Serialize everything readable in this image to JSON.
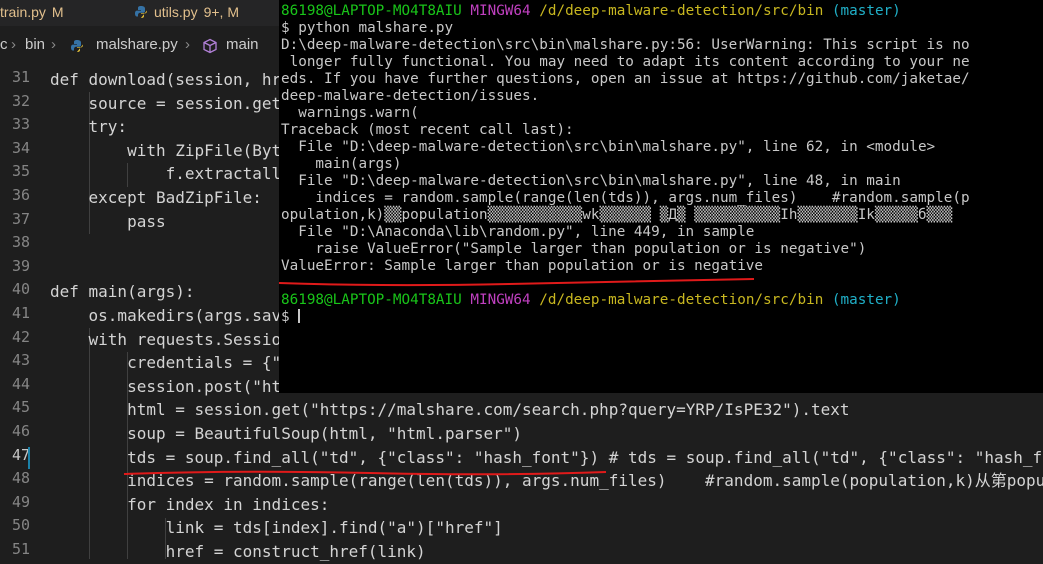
{
  "tabs": [
    {
      "name": "train.py",
      "status": "M"
    },
    {
      "name": "utils.py",
      "status": "9+, M"
    }
  ],
  "breadcrumb": [
    "c",
    "bin",
    "malshare.py",
    "main"
  ],
  "code": {
    "line_numbers": [
      "31",
      "32",
      "33",
      "34",
      "35",
      "36",
      "37",
      "38",
      "39",
      "40",
      "41",
      "42",
      "43",
      "44",
      "45",
      "46",
      "47",
      "48",
      "49",
      "50",
      "51"
    ],
    "lines": [
      "def download(session, hre",
      "    source = session.get",
      "    try:",
      "        with ZipFile(Byt",
      "            f.extractall",
      "    except BadZipFile:",
      "        pass",
      "",
      "",
      "def main(args):",
      "    os.makedirs(args.sav",
      "    with requests.Sessio",
      "        credentials = {\"",
      "        session.post(\"ht",
      "        html = session.get(\"https://malshare.com/search.php?query=YRP/IsPE32\").text",
      "        soup = BeautifulSoup(html, \"html.parser\")",
      "        tds = soup.find_all(\"td\", {\"class\": \"hash_font\"}) # tds = soup.find_all(\"td\", {\"class\": \"hash_fo",
      "        indices = random.sample(range(len(tds)), args.num_files)    #random.sample(population,k)从第popu",
      "        for index in indices:",
      "            link = tds[index].find(\"a\")[\"href\"]",
      "            href = construct_href(link)"
    ]
  },
  "terminal": {
    "prompt_user": "86198@LAPTOP-MO4T8AIU",
    "prompt_env": "MINGW64",
    "prompt_path": "/d/deep-malware-detection/src/bin",
    "prompt_branch": "(master)",
    "command": "$ python malshare.py",
    "output": [
      "D:\\deep-malware-detection\\src\\bin\\malshare.py:56: UserWarning: This script is no",
      " longer fully functional. You may need to adapt its content according to your ne",
      "eds. If you have further questions, open an issue at https://github.com/jaketae/",
      "deep-malware-detection/issues.",
      "  warnings.warn(",
      "Traceback (most recent call last):",
      "  File \"D:\\deep-malware-detection\\src\\bin\\malshare.py\", line 62, in <module>",
      "    main(args)",
      "  File \"D:\\deep-malware-detection\\src\\bin\\malshare.py\", line 48, in main",
      "    indices = random.sample(range(len(tds)), args.num_files)    #random.sample(p",
      "opulation,k)▒▒population▒▒▒▒▒▒▒▒▒▒▒wk▒▒▒▒▒▒ ▒Д▒ ▒▒▒▒▒▒▒▒▒▒Ih▒▒▒▒▒▒▒Ik▒▒▒▒▒б▒▒▒",
      "  File \"D:\\Anaconda\\lib\\random.py\", line 449, in sample",
      "    raise ValueError(\"Sample larger than population or is negative\")",
      "ValueError: Sample larger than population or is negative"
    ],
    "input_prompt": "$ "
  }
}
